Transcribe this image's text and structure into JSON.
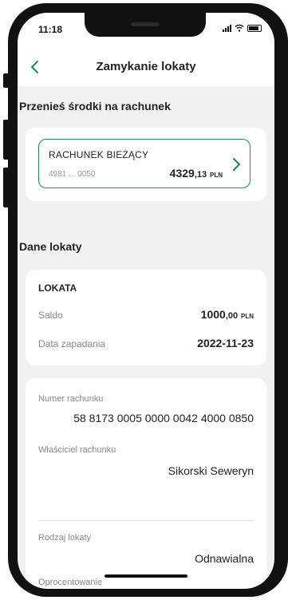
{
  "status_bar": {
    "time": "11:18"
  },
  "header": {
    "title": "Zamykanie lokaty"
  },
  "transfer_section": {
    "title": "Przenieś środki na rachunek"
  },
  "account": {
    "name": "RACHUNEK BIEŻĄCY",
    "number": "4981 ... 0050",
    "balance_int": "4329",
    "balance_dec": ",13",
    "currency": "PLN"
  },
  "deposit_section": {
    "title": "Dane lokaty"
  },
  "deposit": {
    "title": "LOKATA",
    "balance_label": "Saldo",
    "balance_int": "1000",
    "balance_dec": ",00",
    "currency": "PLN",
    "maturity_label": "Data zapadania",
    "maturity_date": "2022-11-23"
  },
  "details": {
    "account_number_label": "Numer rachunku",
    "account_number": "58 8173 0005 0000 0042 4000 0850",
    "owner_label": "Właściciel rachunku",
    "owner": "Sikorski Seweryn",
    "type_label": "Rodzaj lokaty",
    "type": "Odnawialna",
    "interest_label": "Oprocentowanie"
  },
  "colors": {
    "accent": "#1e8a55",
    "background": "#f1f1f1"
  }
}
